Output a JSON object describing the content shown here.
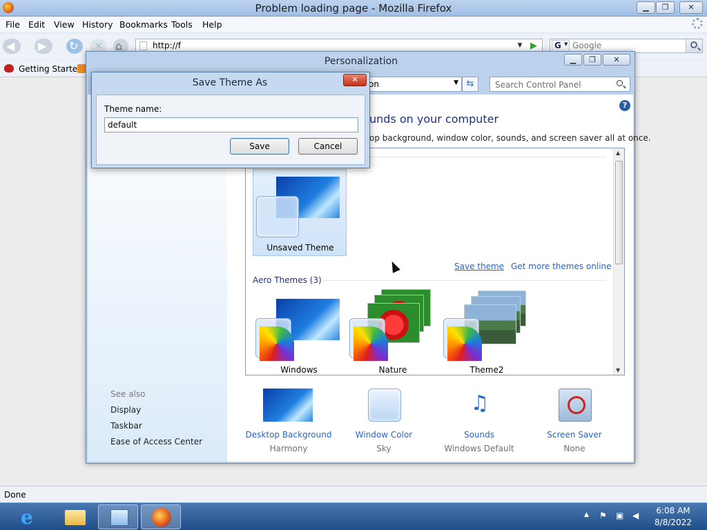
{
  "firefox": {
    "title": "Problem loading page - Mozilla Firefox",
    "menu": [
      "File",
      "Edit",
      "View",
      "History",
      "Bookmarks",
      "Tools",
      "Help"
    ],
    "url": "http://f",
    "search_placeholder": "Google",
    "search_engine": "G",
    "bookmark": "Getting Started",
    "status": "Done"
  },
  "personalization": {
    "title": "Personalization",
    "address": "on",
    "search_placeholder": "Search Control Panel",
    "heading": "unds on your computer",
    "subtitle": "op background, window color, sounds, and screen saver all at once.",
    "unsaved_theme": "Unsaved Theme",
    "save_theme_link": "Save theme",
    "more_themes_link": "Get more themes online",
    "aero_heading": "Aero Themes (3)",
    "themes": [
      "Windows",
      "Nature",
      "Theme2"
    ],
    "see_also": "See also",
    "see_also_links": [
      "Display",
      "Taskbar",
      "Ease of Access Center"
    ],
    "bottom": [
      {
        "title": "Desktop Background",
        "value": "Harmony",
        "icon": "desktop-background-icon"
      },
      {
        "title": "Window Color",
        "value": "Sky",
        "icon": "window-color-icon"
      },
      {
        "title": "Sounds",
        "value": "Windows Default",
        "icon": "sounds-icon"
      },
      {
        "title": "Screen Saver",
        "value": "None",
        "icon": "screen-saver-icon"
      }
    ]
  },
  "save_dialog": {
    "title": "Save Theme As",
    "label": "Theme name:",
    "value": "default",
    "save": "Save",
    "cancel": "Cancel"
  },
  "taskbar": {
    "time": "6:08 AM",
    "date": "8/8/2022"
  },
  "colors": {
    "link": "#2266cc",
    "heading": "#1e3287",
    "taskbar": "#1f4d88"
  }
}
